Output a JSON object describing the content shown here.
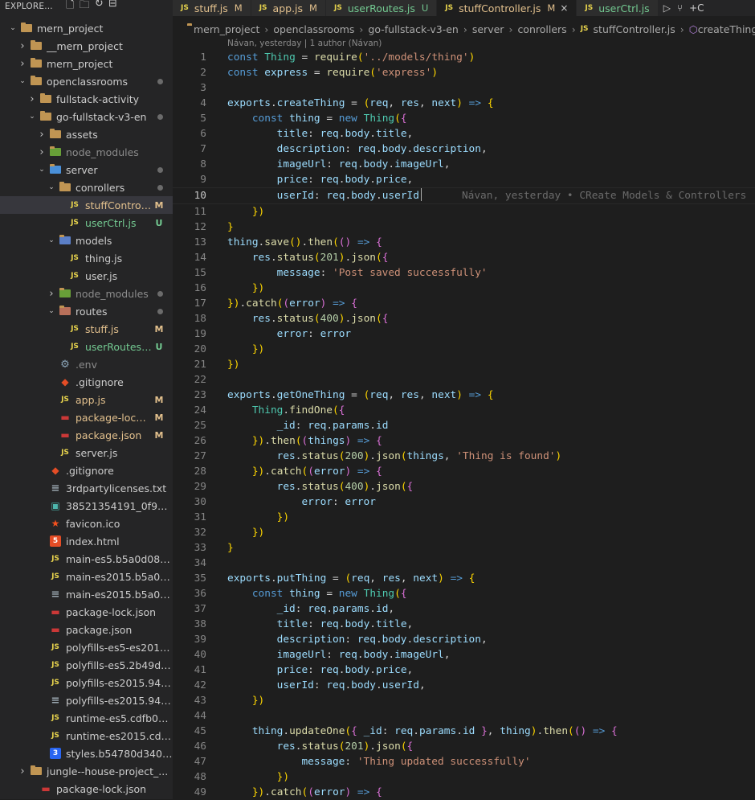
{
  "explorer": {
    "title": "EXPLORE...",
    "items": [
      {
        "label": "mern_project",
        "depth": 0,
        "type": "folder",
        "open": true,
        "badge": "",
        "dot": false
      },
      {
        "label": "__mern_project",
        "depth": 1,
        "type": "folder",
        "open": false,
        "badge": "",
        "dot": false
      },
      {
        "label": "mern_project",
        "depth": 1,
        "type": "folder",
        "open": false,
        "badge": "",
        "dot": false
      },
      {
        "label": "openclassrooms",
        "depth": 1,
        "type": "folder",
        "open": true,
        "badge": "",
        "dot": true
      },
      {
        "label": "fullstack-activity",
        "depth": 2,
        "type": "folder",
        "open": false,
        "badge": "",
        "dot": false
      },
      {
        "label": "go-fullstack-v3-en",
        "depth": 2,
        "type": "folder",
        "open": true,
        "badge": "",
        "dot": true
      },
      {
        "label": "assets",
        "depth": 3,
        "type": "folder",
        "open": false,
        "badge": "",
        "dot": false
      },
      {
        "label": "node_modules",
        "depth": 3,
        "type": "node-folder",
        "open": false,
        "badge": "",
        "dot": false,
        "dim": true
      },
      {
        "label": "server",
        "depth": 3,
        "type": "server-folder",
        "open": true,
        "badge": "",
        "dot": true
      },
      {
        "label": "conrollers",
        "depth": 4,
        "type": "folder",
        "open": true,
        "badge": "",
        "dot": true
      },
      {
        "label": "stuffControlle...",
        "depth": 5,
        "type": "js",
        "badge": "M",
        "dot": false,
        "selected": true
      },
      {
        "label": "userCtrl.js",
        "depth": 5,
        "type": "js",
        "badge": "U",
        "dot": false,
        "untracked": true
      },
      {
        "label": "models",
        "depth": 4,
        "type": "models-folder",
        "open": true,
        "badge": "",
        "dot": false
      },
      {
        "label": "thing.js",
        "depth": 5,
        "type": "js",
        "badge": "",
        "dot": false
      },
      {
        "label": "user.js",
        "depth": 5,
        "type": "js",
        "badge": "",
        "dot": false
      },
      {
        "label": "node_modules",
        "depth": 4,
        "type": "node-folder",
        "open": false,
        "badge": "",
        "dot": true,
        "dim": true
      },
      {
        "label": "routes",
        "depth": 4,
        "type": "routes-folder",
        "open": true,
        "badge": "",
        "dot": true
      },
      {
        "label": "stuff.js",
        "depth": 5,
        "type": "js",
        "badge": "M",
        "dot": false
      },
      {
        "label": "userRoutes.js",
        "depth": 5,
        "type": "js",
        "badge": "U",
        "dot": false,
        "untracked": true
      },
      {
        "label": ".env",
        "depth": 4,
        "type": "gear",
        "badge": "",
        "dot": false,
        "dim": true
      },
      {
        "label": ".gitignore",
        "depth": 4,
        "type": "git",
        "badge": "",
        "dot": false
      },
      {
        "label": "app.js",
        "depth": 4,
        "type": "js",
        "badge": "M",
        "dot": false
      },
      {
        "label": "package-lock.j...",
        "depth": 4,
        "type": "npm",
        "badge": "M",
        "dot": false
      },
      {
        "label": "package.json",
        "depth": 4,
        "type": "npm",
        "badge": "M",
        "dot": false
      },
      {
        "label": "server.js",
        "depth": 4,
        "type": "js",
        "badge": "",
        "dot": false
      },
      {
        "label": ".gitignore",
        "depth": 3,
        "type": "git",
        "badge": "",
        "dot": false
      },
      {
        "label": "3rdpartylicenses.txt",
        "depth": 3,
        "type": "txt",
        "badge": "",
        "dot": false
      },
      {
        "label": "38521354191_0f9b60...",
        "depth": 3,
        "type": "img",
        "badge": "",
        "dot": false
      },
      {
        "label": "favicon.ico",
        "depth": 3,
        "type": "ico",
        "badge": "",
        "dot": false
      },
      {
        "label": "index.html",
        "depth": 3,
        "type": "html",
        "badge": "",
        "dot": false
      },
      {
        "label": "main-es5.b5a0d08d9f...",
        "depth": 3,
        "type": "js",
        "badge": "",
        "dot": false
      },
      {
        "label": "main-es2015.b5a0d0...",
        "depth": 3,
        "type": "js",
        "badge": "",
        "dot": false
      },
      {
        "label": "main-es2015.b5a0d0...",
        "depth": 3,
        "type": "txt",
        "badge": "",
        "dot": false
      },
      {
        "label": "package-lock.json",
        "depth": 3,
        "type": "npm",
        "badge": "",
        "dot": false
      },
      {
        "label": "package.json",
        "depth": 3,
        "type": "npm",
        "badge": "",
        "dot": false
      },
      {
        "label": "polyfills-es5-es2015.2...",
        "depth": 3,
        "type": "js",
        "badge": "",
        "dot": false
      },
      {
        "label": "polyfills-es5.2b49def4...",
        "depth": 3,
        "type": "js",
        "badge": "",
        "dot": false
      },
      {
        "label": "polyfills-es2015.94d3...",
        "depth": 3,
        "type": "js",
        "badge": "",
        "dot": false
      },
      {
        "label": "polyfills-es2015.94d3...",
        "depth": 3,
        "type": "txt",
        "badge": "",
        "dot": false
      },
      {
        "label": "runtime-es5.cdfb0dd...",
        "depth": 3,
        "type": "js",
        "badge": "",
        "dot": false
      },
      {
        "label": "runtime-es2015.cdfb0...",
        "depth": 3,
        "type": "js",
        "badge": "",
        "dot": false
      },
      {
        "label": "styles.b54780d340b0...",
        "depth": 3,
        "type": "css",
        "badge": "",
        "dot": false
      },
      {
        "label": "jungle--house-project_...",
        "depth": 1,
        "type": "folder",
        "open": false,
        "badge": "",
        "dot": false
      },
      {
        "label": "package-lock.json",
        "depth": 2,
        "type": "npm",
        "badge": "",
        "dot": false
      }
    ]
  },
  "tabs": [
    {
      "label": "stuff.js",
      "badge": "M",
      "active": false,
      "color": "#e2c08d"
    },
    {
      "label": "app.js",
      "badge": "M",
      "active": false,
      "color": "#e2c08d"
    },
    {
      "label": "userRoutes.js",
      "badge": "U",
      "active": false,
      "color": "#73c991"
    },
    {
      "label": "stuffController.js",
      "badge": "M",
      "active": true,
      "color": "#e2c08d",
      "close": "×"
    },
    {
      "label": "userCtrl.js",
      "badge": "",
      "active": false,
      "color": "#73c991"
    }
  ],
  "breadcrumb": {
    "items": [
      "mern_project",
      "openclassrooms",
      "go-fullstack-v3-en",
      "server",
      "conrollers"
    ],
    "file": "stuffController.js",
    "symbol": "createThing"
  },
  "blame_header": "Návan, yesterday | 1 author (Návan)",
  "current_line": 10,
  "inline_blame": "Návan, yesterday • CReate Models & Controllers",
  "lines": [
    "const Thing = require('../models/thing')",
    "const express = require('express')",
    "",
    "exports.createThing = (req, res, next) => {",
    "    const thing = new Thing({",
    "        title: req.body.title,",
    "        description: req.body.description,",
    "        imageUrl: req.body.imageUrl,",
    "        price: req.body.price,",
    "        userId: req.body.userId",
    "    })",
    "}",
    "thing.save().then(() => {",
    "    res.status(201).json({",
    "        message: 'Post saved successfully'",
    "    })",
    "}).catch((error) => {",
    "    res.status(400).json({",
    "        error: error",
    "    })",
    "})",
    "",
    "exports.getOneThing = (req, res, next) => {",
    "    Thing.findOne({",
    "        _id: req.params.id",
    "    }).then((things) => {",
    "        res.status(200).json(things, 'Thing is found')",
    "    }).catch((error) => {",
    "        res.status(400).json({",
    "            error: error",
    "        })",
    "    })",
    "}",
    "",
    "exports.putThing = (req, res, next) => {",
    "    const thing = new Thing({",
    "        _id: req.params.id,",
    "        title: req.body.title,",
    "        description: req.body.description,",
    "        imageUrl: req.body.imageUrl,",
    "        price: req.body.price,",
    "        userId: req.body.userId,",
    "    })",
    "",
    "    thing.updateOne({ _id: req.params.id }, thing).then(() => {",
    "        res.status(201).json({",
    "            message: 'Thing updated successfully'",
    "        })",
    "    }).catch((error) => {"
  ]
}
